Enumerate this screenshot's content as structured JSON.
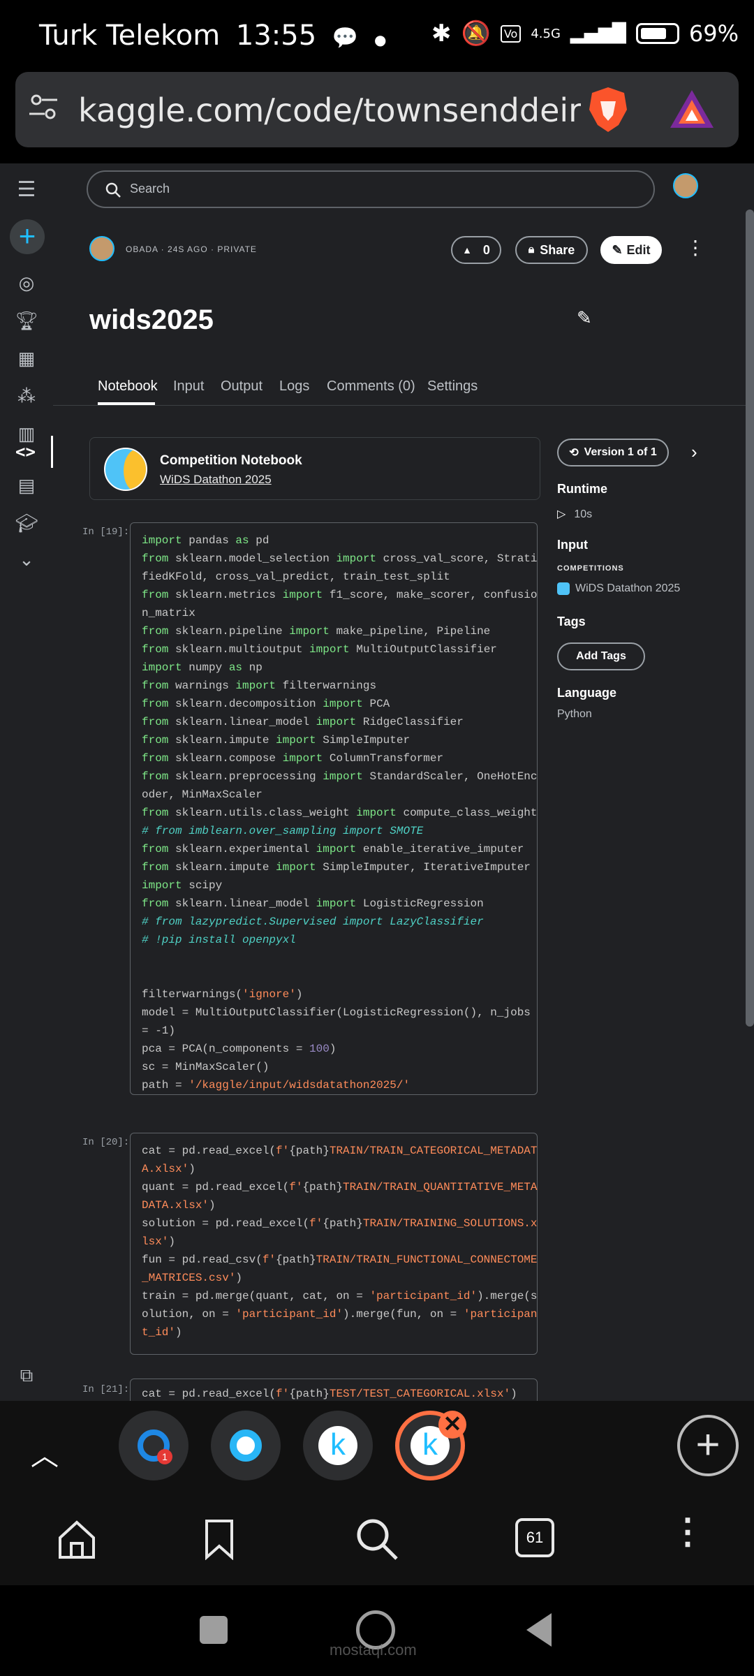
{
  "status": {
    "carrier": "Turk Telekom",
    "time": "13:55",
    "network": "4.5G",
    "battery": "69%"
  },
  "url": {
    "text": "kaggle.com/code/townsenddeirecti"
  },
  "kaggle": {
    "search_placeholder": "Search",
    "meta": "OBADA · 24S AGO · PRIVATE",
    "vote_count": "0",
    "share_label": "Share",
    "edit_label": "Edit",
    "title": "wids2025",
    "tabs": [
      "Notebook",
      "Input",
      "Output",
      "Logs",
      "Comments (0)",
      "Settings"
    ],
    "competition": {
      "title": "Competition Notebook",
      "link": "WiDS Datathon 2025"
    },
    "version_label": "Version 1 of 1",
    "sidebar": {
      "runtime_h": "Runtime",
      "runtime": "10s",
      "input_h": "Input",
      "competitions_h": "COMPETITIONS",
      "competition_name": "WiDS Datathon 2025",
      "tags_h": "Tags",
      "add_tags": "Add Tags",
      "language_h": "Language",
      "language": "Python"
    },
    "cells": [
      {
        "label": "In [19]:"
      },
      {
        "label": "In [20]:"
      },
      {
        "label": "In [21]:"
      }
    ]
  },
  "browser": {
    "tabs_count": "61"
  },
  "watermark": "mostaql.com"
}
